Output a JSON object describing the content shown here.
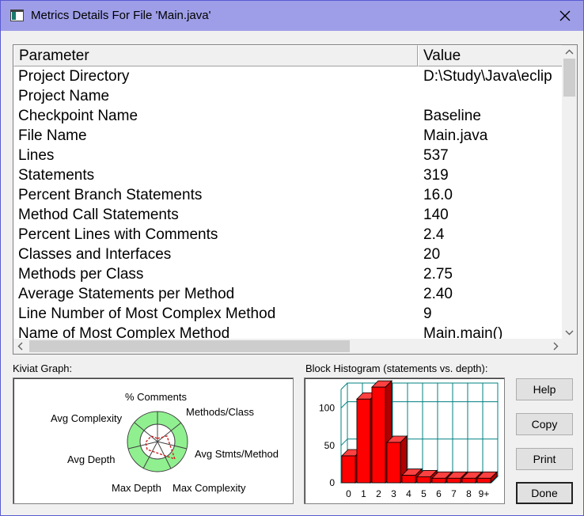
{
  "window": {
    "title": "Metrics Details For File 'Main.java'"
  },
  "table": {
    "columns": [
      "Parameter",
      "Value"
    ],
    "rows": [
      {
        "parameter": "Project Directory",
        "value": "D:\\Study\\Java\\eclip"
      },
      {
        "parameter": "Project Name",
        "value": ""
      },
      {
        "parameter": "Checkpoint Name",
        "value": "Baseline"
      },
      {
        "parameter": "File Name",
        "value": "Main.java"
      },
      {
        "parameter": "Lines",
        "value": "537"
      },
      {
        "parameter": "Statements",
        "value": "319"
      },
      {
        "parameter": "Percent Branch Statements",
        "value": "16.0"
      },
      {
        "parameter": "Method Call Statements",
        "value": "140"
      },
      {
        "parameter": "Percent Lines with Comments",
        "value": "2.4"
      },
      {
        "parameter": "Classes and Interfaces",
        "value": "20"
      },
      {
        "parameter": "Methods per Class",
        "value": "2.75"
      },
      {
        "parameter": "Average Statements per Method",
        "value": "2.40"
      },
      {
        "parameter": "Line Number of Most Complex Method",
        "value": "9"
      },
      {
        "parameter": "Name of Most Complex Method",
        "value": "Main.main()"
      }
    ]
  },
  "kiviat": {
    "label": "Kiviat Graph:",
    "axes": [
      "% Comments",
      "Methods/Class",
      "Avg Stmts/Method",
      "Max Complexity",
      "Max Depth",
      "Avg Depth",
      "Avg Complexity"
    ]
  },
  "histogram": {
    "label": "Block Histogram (statements vs. depth):"
  },
  "chart_data": {
    "type": "bar",
    "title": "Block Histogram (statements vs. depth):",
    "categories": [
      "0",
      "1",
      "2",
      "3",
      "4",
      "5",
      "6",
      "7",
      "8",
      "9+"
    ],
    "values": [
      36,
      112,
      128,
      54,
      10,
      8,
      6,
      6,
      6,
      6
    ],
    "y_ticks": [
      0,
      50,
      100
    ],
    "ylim": [
      0,
      125
    ],
    "bar_color": "#ff0000",
    "grid_color": "#008080"
  },
  "buttons": {
    "help": "Help",
    "copy": "Copy",
    "print": "Print",
    "done": "Done"
  }
}
